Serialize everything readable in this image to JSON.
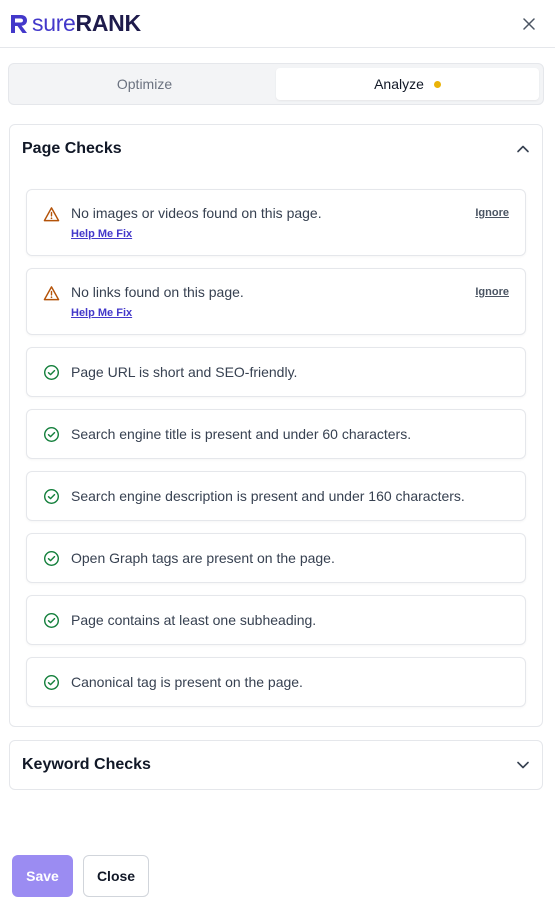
{
  "header": {
    "logo": {
      "word_a": "sure",
      "word_b": "RANK",
      "brand_color": "#4338ca"
    },
    "close_icon": "close-icon"
  },
  "tabs": [
    {
      "label": "Optimize",
      "active": false
    },
    {
      "label": "Analyze",
      "active": true,
      "indicator_color": "#eab308"
    }
  ],
  "page_checks": {
    "title": "Page Checks",
    "expanded": true,
    "items": [
      {
        "status": "warning",
        "text": "No images or videos found on this page.",
        "fix_label": "Help Me Fix",
        "ignore_label": "Ignore"
      },
      {
        "status": "warning",
        "text": "No links found on this page.",
        "fix_label": "Help Me Fix",
        "ignore_label": "Ignore"
      },
      {
        "status": "pass",
        "text": "Page URL is short and SEO-friendly."
      },
      {
        "status": "pass",
        "text": "Search engine title is present and under 60 characters."
      },
      {
        "status": "pass",
        "text": "Search engine description is present and under 160 characters."
      },
      {
        "status": "pass",
        "text": "Open Graph tags are present on the page."
      },
      {
        "status": "pass",
        "text": "Page contains at least one subheading."
      },
      {
        "status": "pass",
        "text": "Canonical tag is present on the page."
      }
    ]
  },
  "keyword_checks": {
    "title": "Keyword Checks",
    "expanded": false
  },
  "footer": {
    "save_label": "Save",
    "close_label": "Close"
  },
  "colors": {
    "warning": "#b45309",
    "pass": "#15803d",
    "link": "#4338ca",
    "save_button": "#9b8cf2"
  }
}
